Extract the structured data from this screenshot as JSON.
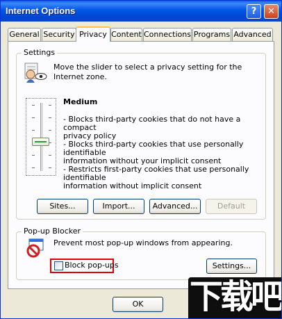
{
  "window": {
    "title": "Internet Options",
    "help_label": "?",
    "close_label": "✕"
  },
  "tabs": [
    {
      "label": "General"
    },
    {
      "label": "Security"
    },
    {
      "label": "Privacy"
    },
    {
      "label": "Content"
    },
    {
      "label": "Connections"
    },
    {
      "label": "Programs"
    },
    {
      "label": "Advanced"
    }
  ],
  "active_tab": "Privacy",
  "settings": {
    "group_label": "Settings",
    "description": "Move the slider to select a privacy setting for the Internet zone.",
    "slider_level_label": "Medium",
    "slider_position_index": 3,
    "slider_positions": 6,
    "level_details": "- Blocks third-party cookies that do not have a compact privacy policy\n- Blocks third-party cookies that use personally identifiable information without your implicit consent\n- Restricts first-party cookies that use personally identifiable information without implicit consent",
    "buttons": {
      "sites": "Sites...",
      "import": "Import...",
      "advanced": "Advanced...",
      "default": "Default"
    }
  },
  "popup_blocker": {
    "group_label": "Pop-up Blocker",
    "description": "Prevent most pop-up windows from appearing.",
    "checkbox_label": "Block pop-ups",
    "checkbox_checked": false,
    "settings_button": "Settings..."
  },
  "footer": {
    "ok_label": "OK"
  },
  "watermark_text": "下载吧",
  "colors": {
    "titlebar": "#0055e5",
    "dialog_bg": "#ece9d8",
    "panel_bg": "#fcfcfe",
    "highlight_border": "#e00000",
    "active_tab_accent": "#ffc83c"
  }
}
